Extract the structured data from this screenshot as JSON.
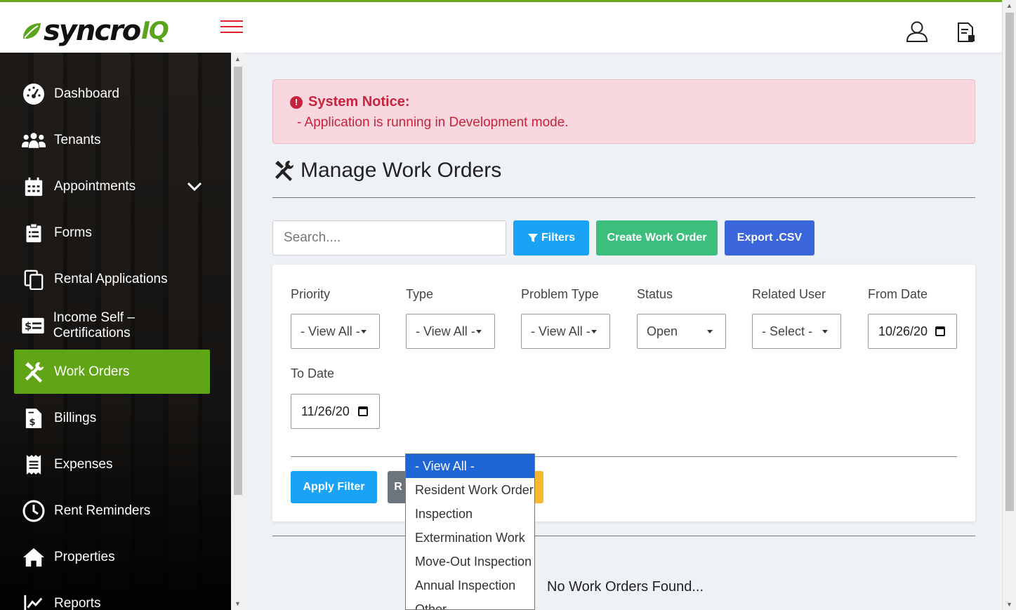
{
  "brand": {
    "name_main": "syncro",
    "name_accent": "IQ",
    "accent_color": "#5fa516"
  },
  "sidebar": {
    "items": [
      {
        "label": "Dashboard",
        "icon": "dashboard-icon"
      },
      {
        "label": "Tenants",
        "icon": "users-icon"
      },
      {
        "label": "Appointments",
        "icon": "calendar-icon"
      },
      {
        "label": "Forms",
        "icon": "clipboard-icon"
      },
      {
        "label": "Rental Applications",
        "icon": "copy-icon"
      },
      {
        "label": "Income Self – Certifications",
        "icon": "money-icon"
      },
      {
        "label": "Work Orders",
        "icon": "tools-icon"
      },
      {
        "label": "Billings",
        "icon": "invoice-icon"
      },
      {
        "label": "Expenses",
        "icon": "receipt-icon"
      },
      {
        "label": "Rent Reminders",
        "icon": "clock-icon"
      },
      {
        "label": "Properties",
        "icon": "home-icon"
      },
      {
        "label": "Reports",
        "icon": "chart-line-icon"
      }
    ],
    "active": "Work Orders"
  },
  "notice": {
    "title": "System Notice:",
    "message": "- Application is running in Development mode."
  },
  "page": {
    "title": "Manage Work Orders"
  },
  "toolbar": {
    "search_placeholder": "Search....",
    "filters_label": "Filters",
    "create_label": "Create Work Order",
    "export_label": "Export .CSV"
  },
  "filters": {
    "priority": {
      "label": "Priority",
      "value": "- View All -"
    },
    "type": {
      "label": "Type",
      "value": "- View All -"
    },
    "problem_type": {
      "label": "Problem Type",
      "value": "- View All -"
    },
    "status": {
      "label": "Status",
      "value": "Open"
    },
    "related_user": {
      "label": "Related User",
      "value": "- Select -"
    },
    "from_date": {
      "label": "From Date",
      "value": "10/26/20"
    },
    "to_date": {
      "label": "To Date",
      "value": "11/26/20"
    },
    "apply_label": "Apply Filter",
    "reset_label": "R"
  },
  "type_dropdown": {
    "options": [
      "- View All -",
      "Resident Work Order",
      "Inspection",
      "Extermination Work",
      "Move-Out Inspection",
      "Annual Inspection",
      "Other"
    ],
    "selected_index": 0
  },
  "results": {
    "empty_message": "No Work Orders Found..."
  }
}
